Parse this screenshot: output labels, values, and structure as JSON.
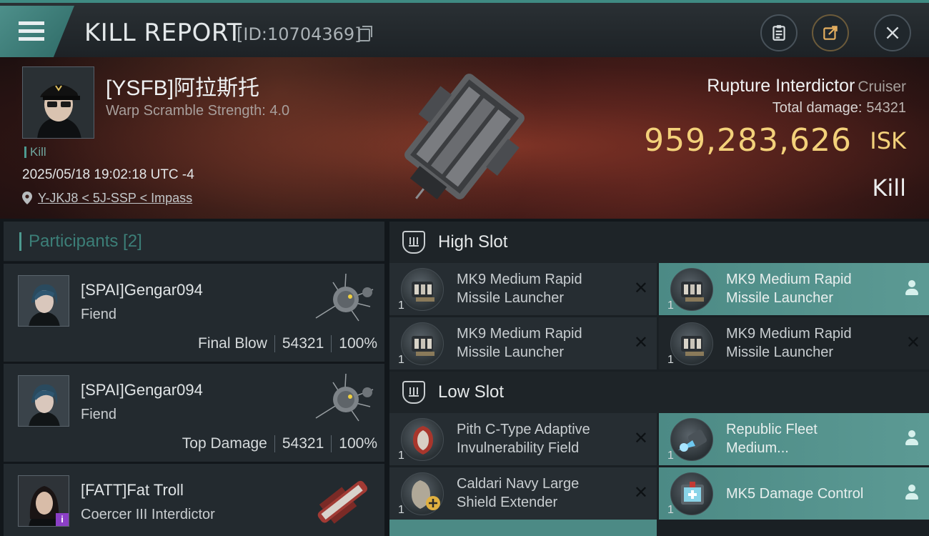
{
  "header": {
    "title": "KILL REPORT",
    "report_id": "[ID:10704369]"
  },
  "banner": {
    "pilot_name": "[YSFB]阿拉斯托",
    "warp_scramble": "Warp Scramble Strength: 4.0",
    "kill_tag": "Kill",
    "datetime": "2025/05/18 19:02:18 UTC -4",
    "location": "Y-JKJ8 < 5J-SSP < Impass",
    "ship_name": "Rupture Interdictor",
    "ship_type": "Cruiser",
    "total_damage_label": "Total damage:",
    "total_damage_value": "54321",
    "isk_value": "959,283,626",
    "isk_unit": "ISK",
    "result": "Kill"
  },
  "participants": {
    "header": "Participants [2]",
    "rows": [
      {
        "name": "[SPAI]Gengar094",
        "ship": "Fiend",
        "role": "Final Blow",
        "damage": "54321",
        "percent": "100%"
      },
      {
        "name": "[SPAI]Gengar094",
        "ship": "Fiend",
        "role": "Top Damage",
        "damage": "54321",
        "percent": "100%"
      },
      {
        "name": "[FATT]Fat Troll",
        "ship": "Coercer III Interdictor",
        "badge": "i"
      }
    ]
  },
  "fitting": {
    "high_slot": {
      "title": "High Slot",
      "modules": [
        {
          "name": "MK9 Medium Rapid Missile Launcher",
          "qty": "1"
        },
        {
          "name": "MK9 Medium Rapid Missile Launcher",
          "qty": "1"
        },
        {
          "name": "MK9 Medium Rapid Missile Launcher",
          "qty": "1"
        },
        {
          "name": "MK9 Medium Rapid Missile Launcher",
          "qty": "1"
        }
      ]
    },
    "low_slot": {
      "title": "Low Slot",
      "modules": [
        {
          "name": "Pith C-Type Adaptive Invulnerability Field",
          "qty": "1"
        },
        {
          "name": "Republic Fleet Medium...",
          "qty": "1"
        },
        {
          "name": "Caldari Navy Large Shield Extender",
          "qty": "1"
        },
        {
          "name": "MK5 Damage Control",
          "qty": "1"
        }
      ]
    }
  },
  "colors": {
    "accent": "#4d9a90",
    "isk": "#f3d17a",
    "fitted_module": "#4c8a85"
  }
}
